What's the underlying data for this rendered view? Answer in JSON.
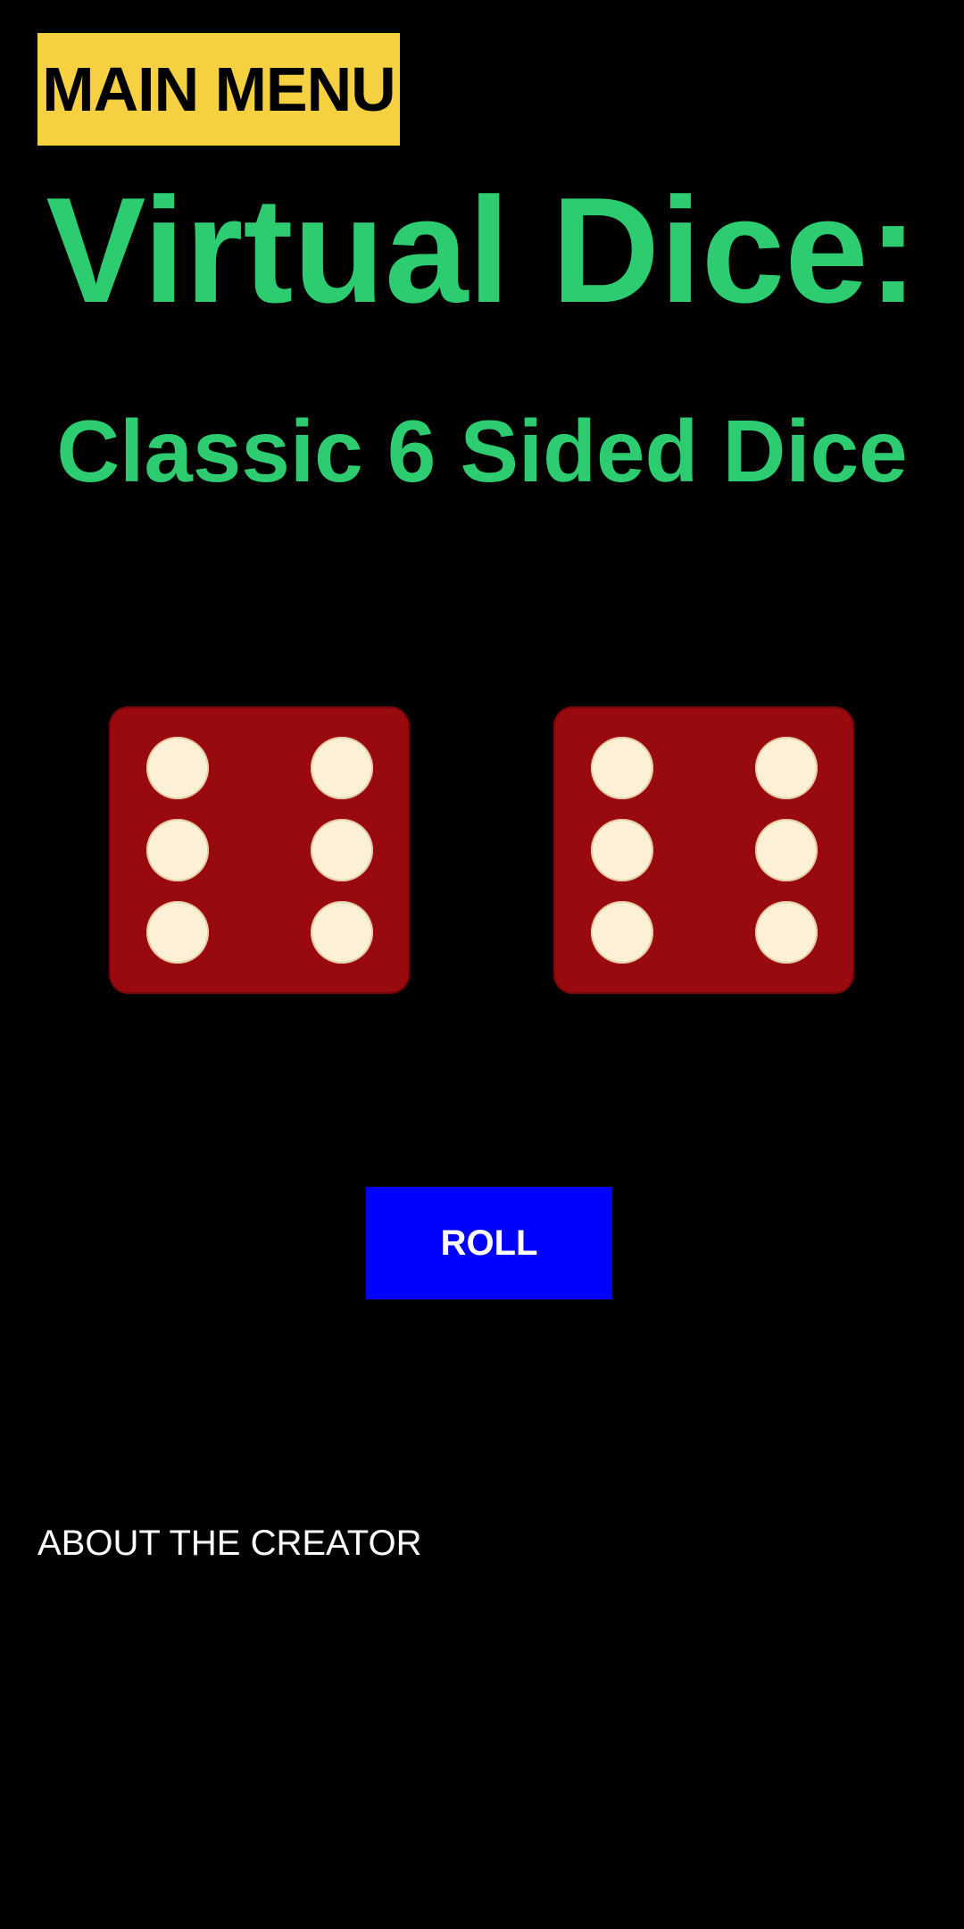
{
  "header": {
    "main_menu_label": "MAIN MENU"
  },
  "title": "Virtual Dice:",
  "subtitle": "Classic 6 Sided Dice",
  "dice": [
    {
      "value": 6
    },
    {
      "value": 6
    }
  ],
  "roll_label": "ROLL",
  "about_label": "ABOUT THE CREATOR",
  "colors": {
    "accent_green": "#2ecc71",
    "menu_yellow": "#f5d041",
    "die_red": "#990a0e",
    "pip_cream": "#fcf0d6",
    "roll_blue": "#0000ff",
    "background": "#000000"
  }
}
